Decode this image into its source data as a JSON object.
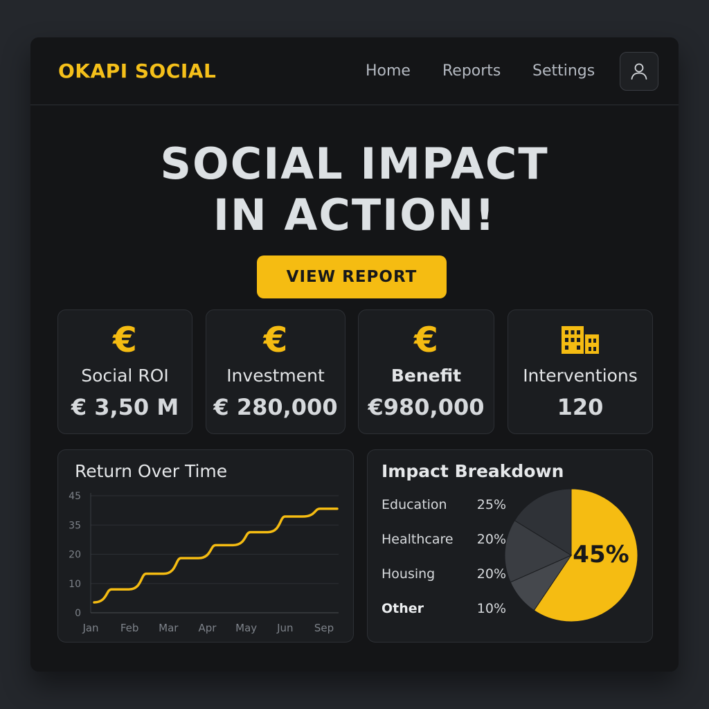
{
  "app": {
    "brand": "OKAPI SOCIAL"
  },
  "nav": {
    "items": [
      {
        "label": "Home"
      },
      {
        "label": "Reports"
      },
      {
        "label": "Settings"
      }
    ],
    "profile_icon": "user-icon"
  },
  "hero": {
    "title_line1": "SOCIAL IMPACT",
    "title_line2": "IN ACTION!",
    "cta_label": "VIEW REPORT"
  },
  "stats": [
    {
      "icon": "euro-icon",
      "glyph": "€",
      "label": "Social ROI",
      "value": "€ 3,50 M"
    },
    {
      "icon": "euro-icon",
      "glyph": "€",
      "label": "Investment",
      "value": "€ 280,000"
    },
    {
      "icon": "euro-icon",
      "glyph": "€",
      "label": "Benefit",
      "value": "€980,000"
    },
    {
      "icon": "building-icon",
      "label": "Interventions",
      "value": "120"
    }
  ],
  "colors": {
    "accent": "#f5bc12",
    "background": "#141517",
    "card": "#1b1d20",
    "pie_dark_1": "#2f3237",
    "pie_dark_2": "#3a3d42",
    "pie_dark_3": "#45484d"
  },
  "return_chart": {
    "title": "Return Over Time",
    "chart_data": {
      "type": "line",
      "title": "Return Over Time",
      "xlabel": "",
      "ylabel": "",
      "categories": [
        "Jan",
        "Feb",
        "Mar",
        "Apr",
        "May",
        "Jun",
        "Sep"
      ],
      "y_tick_labels": [
        "0",
        "10",
        "20",
        "35",
        "45"
      ],
      "values": [
        4,
        9,
        15,
        21,
        26,
        31,
        37,
        40
      ],
      "grid": true
    }
  },
  "impact_breakdown": {
    "title": "Impact Breakdown",
    "chart_data": {
      "type": "pie",
      "title": "Impact Breakdown",
      "slices": [
        {
          "label": "Education",
          "value": 25
        },
        {
          "label": "Healthcare",
          "value": 20
        },
        {
          "label": "Housing",
          "value": 20
        },
        {
          "label": "Other",
          "value": 10
        }
      ],
      "highlight": {
        "value": 45,
        "label": "45%"
      }
    },
    "legend": [
      {
        "label": "Education",
        "pct": "25%"
      },
      {
        "label": "Healthcare",
        "pct": "20%"
      },
      {
        "label": "Housing",
        "pct": "20%"
      },
      {
        "label": "Other",
        "pct": "10%"
      }
    ]
  }
}
